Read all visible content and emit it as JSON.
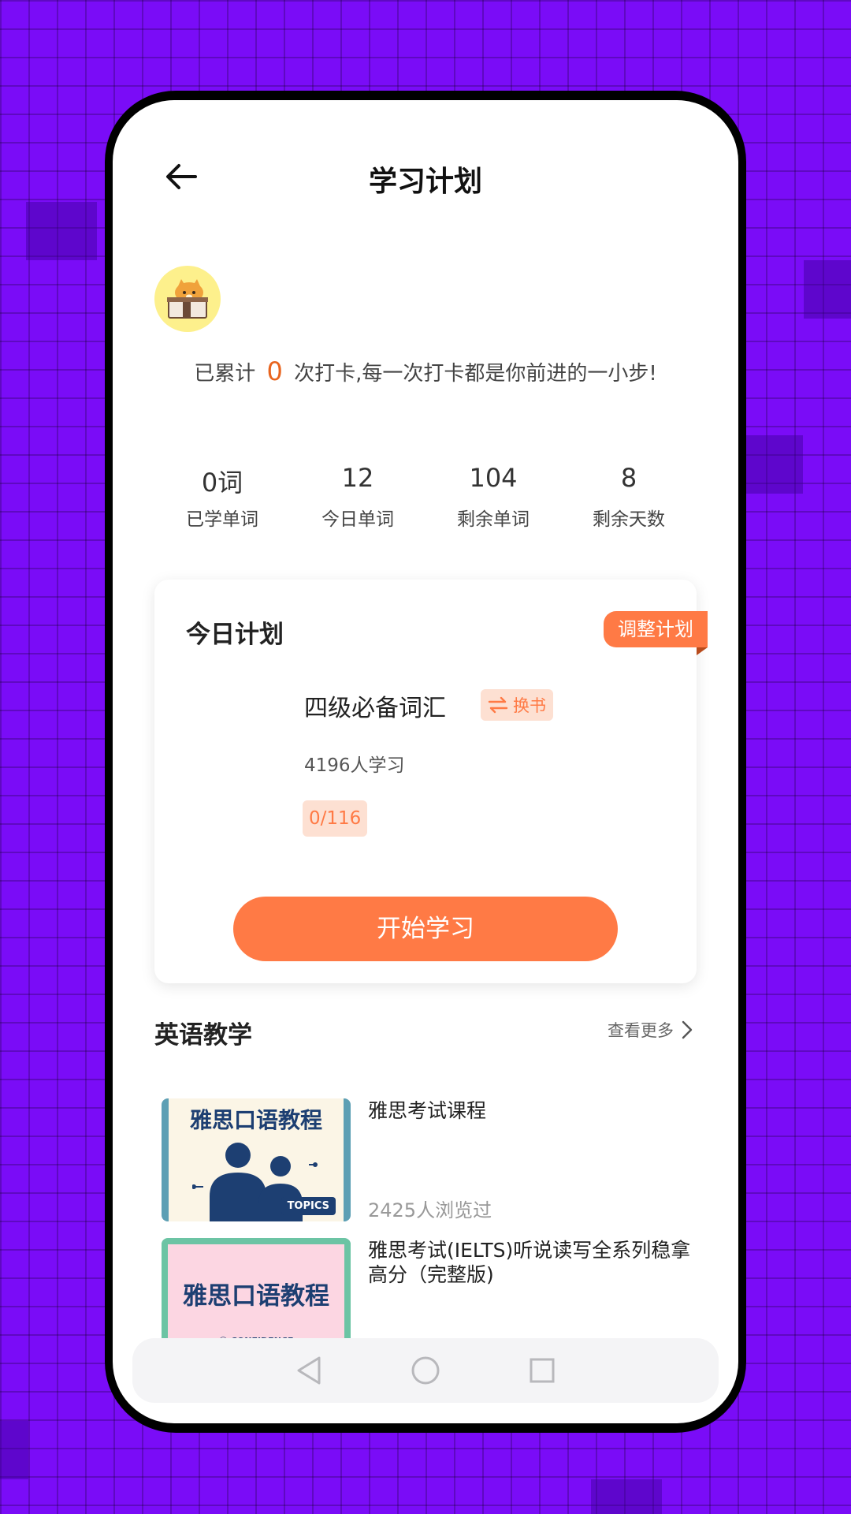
{
  "header": {
    "title": "学习计划"
  },
  "checkin": {
    "prefix": "已累计",
    "count": "0",
    "suffix": "次打卡,每一次打卡都是你前进的一小步!"
  },
  "stats": [
    {
      "value": "0词",
      "label": "已学单词"
    },
    {
      "value": "12",
      "label": "今日单词"
    },
    {
      "value": "104",
      "label": "剩余单词"
    },
    {
      "value": "8",
      "label": "剩余天数"
    }
  ],
  "plan": {
    "title": "今日计划",
    "adjust_label": "调整计划",
    "book_title": "四级必备词汇",
    "swap_label": "换书",
    "learners": "4196人学习",
    "progress": "0/116",
    "start_label": "开始学习"
  },
  "english_teaching": {
    "title": "英语教学",
    "see_more": "查看更多",
    "courses": [
      {
        "thumb_text": "雅思口语教程",
        "thumb_badge": "TOPICS",
        "title": "雅思考试课程",
        "views": "2425人浏览过"
      },
      {
        "thumb_text": "雅思口语教程",
        "thumb_badge": "CONFIDENCE",
        "title": "雅思考试(IELTS)听说读写全系列稳拿高分（完整版)"
      }
    ]
  },
  "colors": {
    "accent": "#ff7a45",
    "accent_light": "#fde0d2",
    "background": "#7a0cf7"
  },
  "icons": {
    "back": "arrow-left-icon",
    "swap": "swap-arrows-icon",
    "see_more": "chevron-right-icon",
    "nav_back": "triangle-back-icon",
    "nav_home": "circle-home-icon",
    "nav_recent": "square-recent-icon"
  }
}
